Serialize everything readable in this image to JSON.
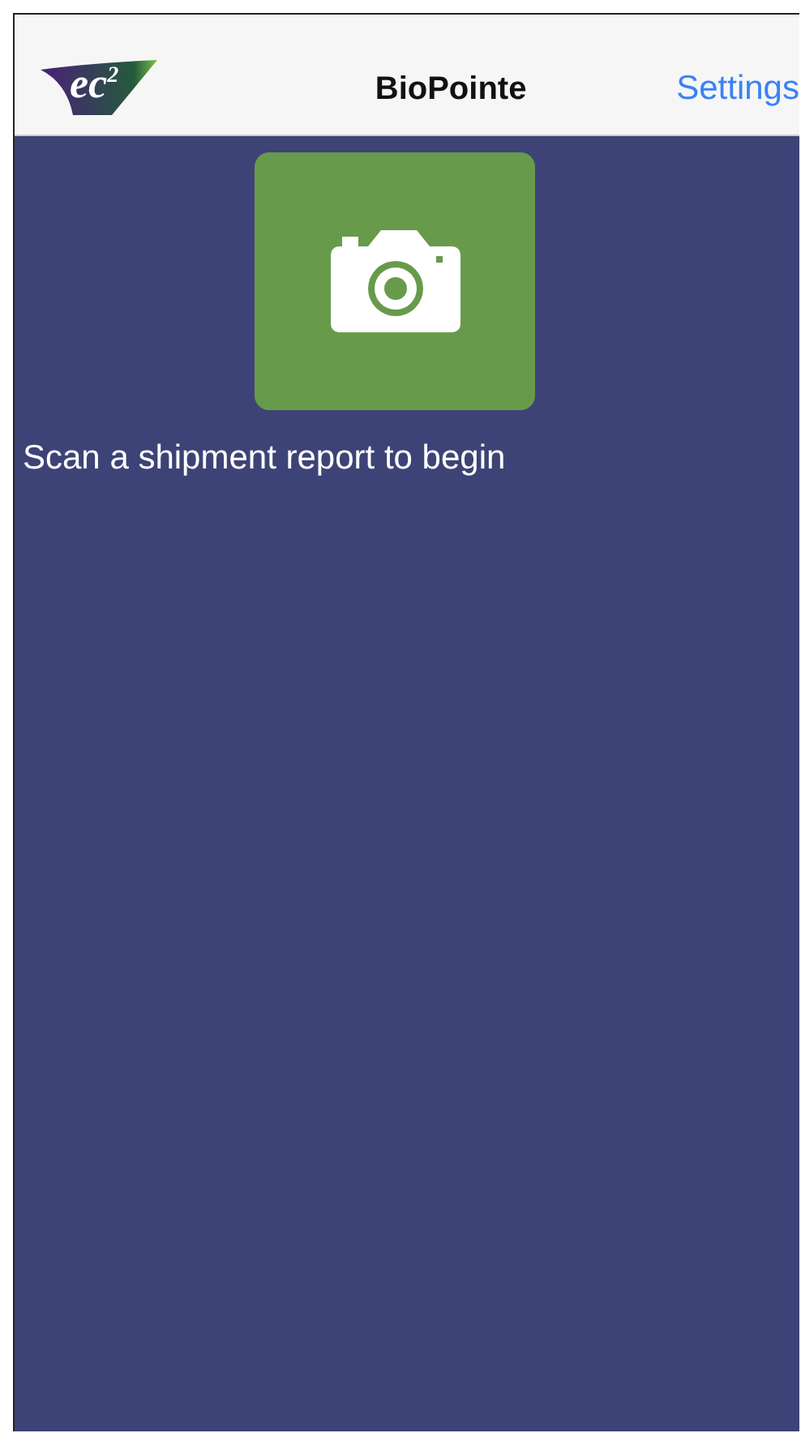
{
  "nav_bar": {
    "logo": "ec$^{2}$",
    "title": "BioPointe",
    "settings_button": "Settings"
  },
  "scan_button": {
    "kind": "camera"
  },
  "prompt": "Scan a shipment report to begin"
}
